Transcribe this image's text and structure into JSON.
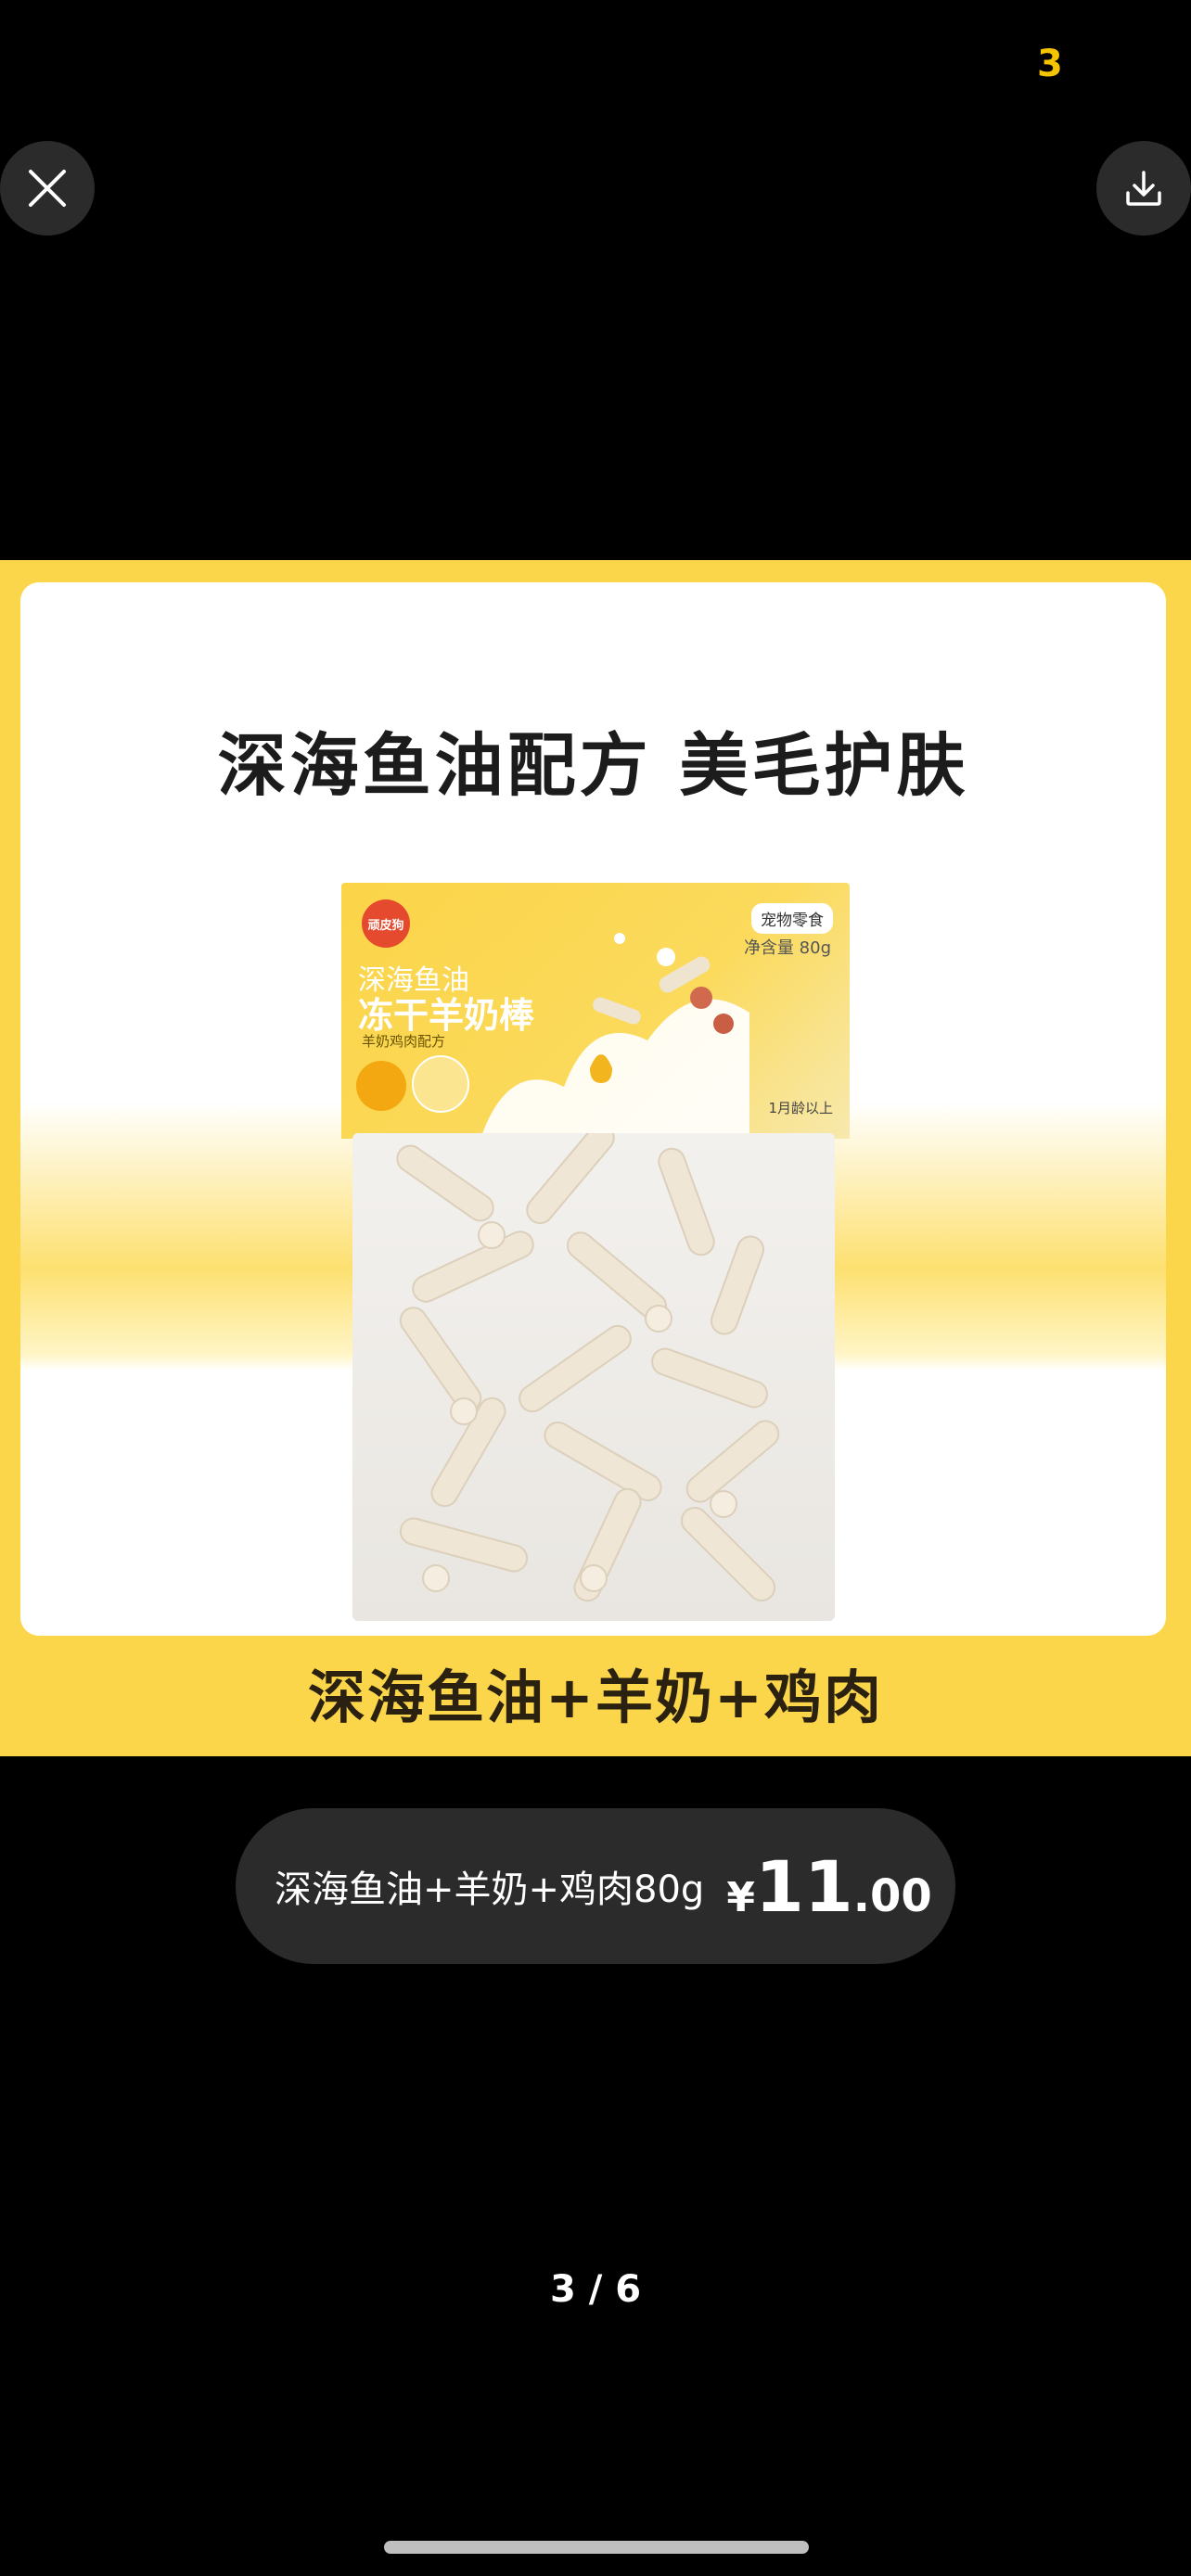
{
  "status_badge_text": "3",
  "toolbar": {
    "close_icon": "close-icon",
    "download_icon": "download-icon"
  },
  "poster": {
    "headline": "深海鱼油配方  美毛护肤",
    "package": {
      "brand": "顽皮狗",
      "tag": "宠物零食",
      "weight": "净含量 80g",
      "line1": "深海鱼油",
      "line2": "冻干羊奶棒",
      "line3": "羊奶鸡肉配方",
      "age": "1月龄以上"
    },
    "caption": "深海鱼油+羊奶+鸡肉",
    "colors": {
      "background": "#fcd64a",
      "card": "#ffffff"
    }
  },
  "product_pill": {
    "title": "深海鱼油+羊奶+鸡肉80g",
    "currency": "¥",
    "price_int": "11",
    "price_dec": ".00"
  },
  "pager": {
    "label": "3 / 6"
  }
}
